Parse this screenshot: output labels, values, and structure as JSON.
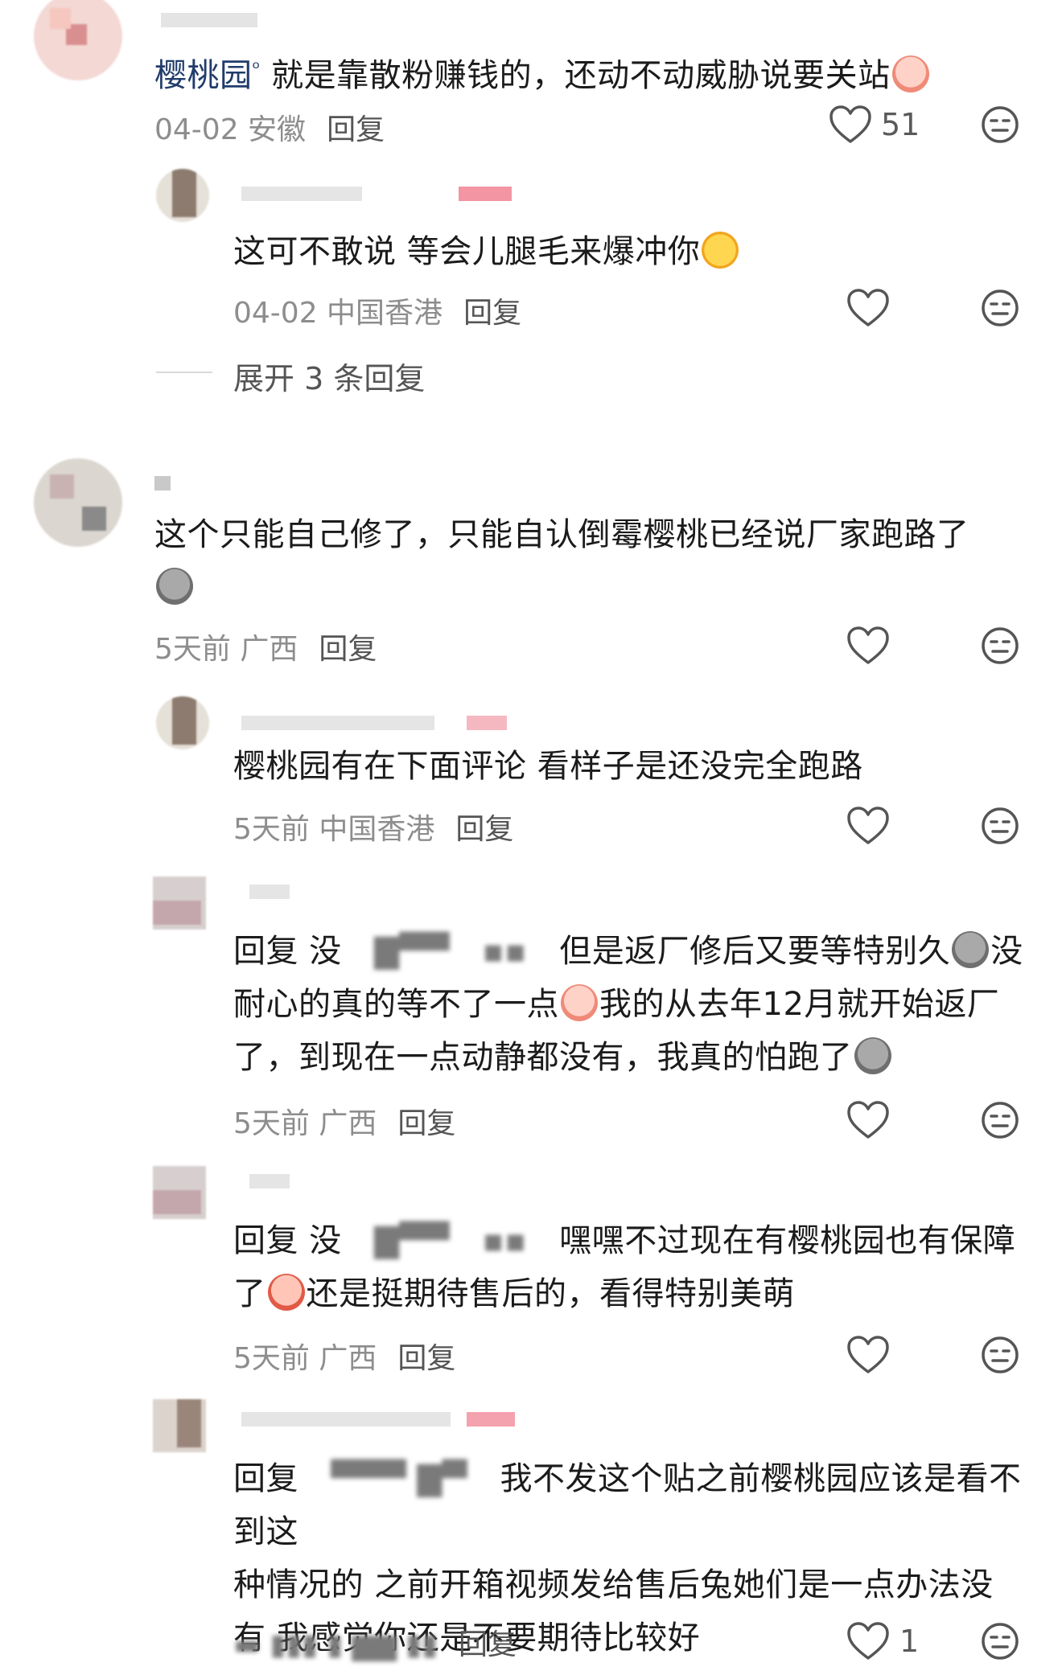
{
  "colors": {
    "text": "#1b1b1b",
    "meta": "#8d8d8d",
    "reply": "#555555",
    "mention": "#213c6b",
    "icon": "#555555"
  },
  "icons": {
    "like": "heart-icon",
    "dislike": "meh-face-icon"
  },
  "comments": [
    {
      "mention": "樱桃园",
      "text": "就是靠散粉赚钱的，还动不动威胁说要关站",
      "meta": "04-02 安徽",
      "reply": "回复",
      "likes": "51"
    },
    {
      "text": "这可不敢说 等会儿腿毛来爆冲你",
      "meta": "04-02 中国香港",
      "reply": "回复",
      "expand": "展开 3 条回复"
    },
    {
      "text": "这个只能自己修了，只能自认倒霉樱桃已经说厂家跑路了",
      "meta": "5天前 广西",
      "reply": "回复"
    },
    {
      "text": "樱桃园有在下面评论 看样子是还没完全跑路",
      "meta": "5天前 中国香港",
      "reply": "回复"
    },
    {
      "prefix": "回复 没",
      "line1": "但是返厂修后又要等特别久",
      "line1b": "没",
      "line2a": "耐心的真的等不了一点",
      "line2b": "我的从去年12月就开始返厂",
      "line3": "了，到现在一点动静都没有，我真的怕跑了",
      "meta": "5天前 广西",
      "reply": "回复"
    },
    {
      "prefix": "回复 没",
      "line1": "嘿嘿不过现在有樱桃园也有保障",
      "line2a": "了",
      "line2b": "还是挺期待售后的，看得特别美萌",
      "meta": "5天前 广西",
      "reply": "回复"
    },
    {
      "prefix": "回复",
      "line1": "我不发这个贴之前樱桃园应该是看不到这",
      "line2": "种情况的 之前开箱视频发给售后兔她们是一点办法没",
      "line3": "有 我感觉你还是不要期待比较好",
      "reply": "回复",
      "likes": "1"
    }
  ]
}
